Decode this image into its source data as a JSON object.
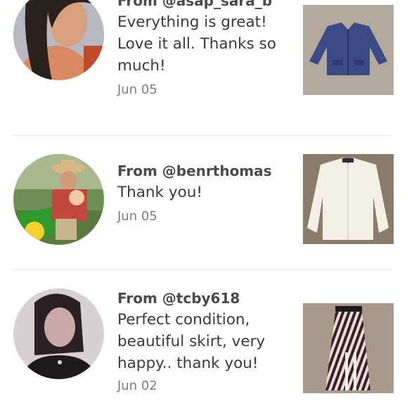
{
  "reviews": [
    {
      "from": "From @asap_sara_b",
      "comment": "Everything is great! Love it all. Thanks so much!",
      "date": "Jun 05",
      "avatar_icon": "avatar-photo-woman-dark-hair",
      "item_icon": "blue-jacket-photo"
    },
    {
      "from": "From @benrthomas",
      "comment": "Thank you!",
      "date": "Jun 05",
      "avatar_icon": "avatar-photo-tractor",
      "item_icon": "white-shirt-photo"
    },
    {
      "from": "From @tcby618",
      "comment": "Perfect condition, beautiful skirt, very happy.. thank you!",
      "date": "Jun 02",
      "avatar_icon": "avatar-photo-woman-bw",
      "item_icon": "striped-skirt-photo"
    }
  ],
  "colors": {
    "text": "#3a3a3a",
    "date": "#7d7d7d",
    "divider": "#e6e6e6"
  }
}
